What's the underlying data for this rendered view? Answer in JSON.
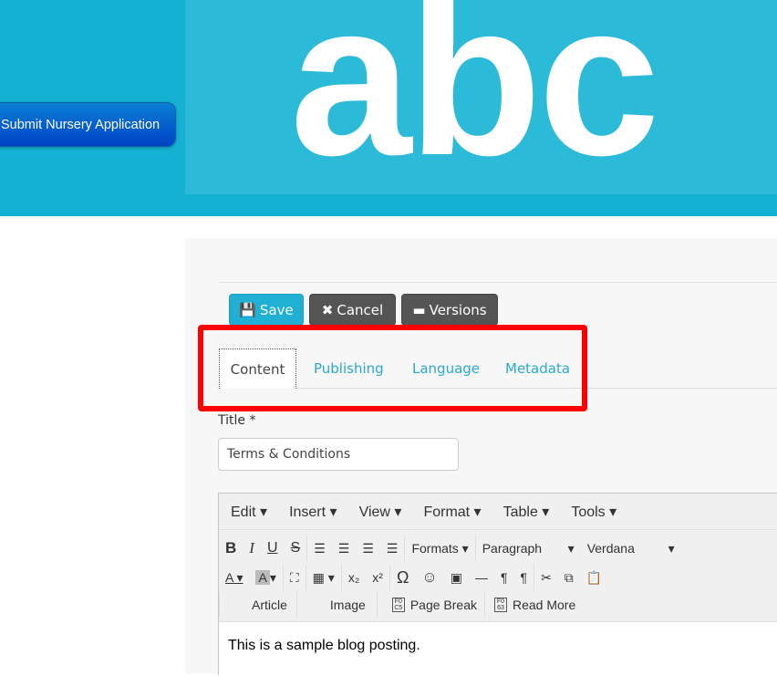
{
  "header": {
    "submit_label": "Submit Nursery Application",
    "logo_text": "abc",
    "colors": {
      "header_bg": "#14b1d2",
      "logo_bg": "#2bbad8"
    }
  },
  "toolbar": {
    "save": "Save",
    "cancel": "Cancel",
    "versions": "Versions"
  },
  "tabs": [
    {
      "label": "Content",
      "active": true
    },
    {
      "label": "Publishing"
    },
    {
      "label": "Language"
    },
    {
      "label": "Metadata"
    }
  ],
  "form": {
    "title_label": "Title *",
    "title_value": "Terms & Conditions"
  },
  "editor": {
    "menu": [
      "Edit",
      "Insert",
      "View",
      "Format",
      "Table",
      "Tools"
    ],
    "formats": "Formats",
    "paragraph": "Paragraph",
    "font": "Verdana",
    "buttons": [
      "Article",
      "Image",
      "Page Break",
      "Read More"
    ],
    "content": "This is a sample blog posting."
  }
}
